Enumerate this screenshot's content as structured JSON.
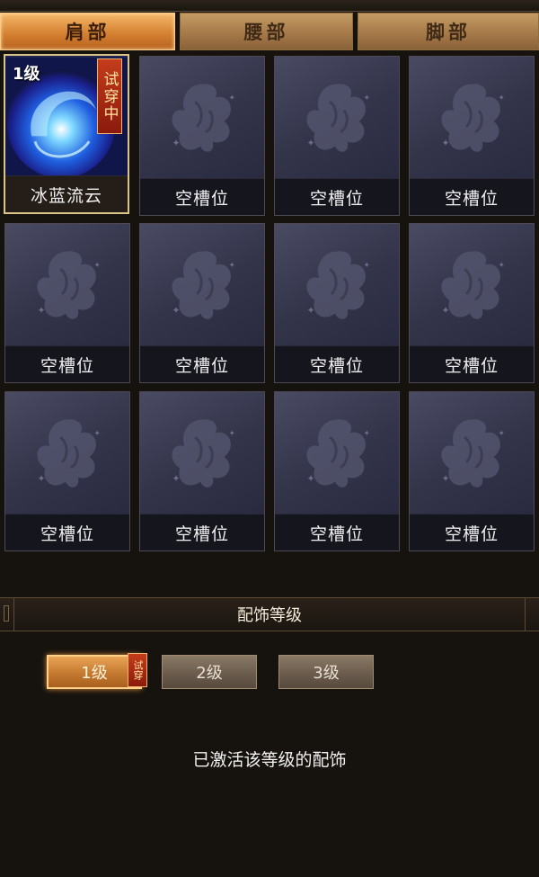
{
  "tabs": [
    {
      "label": "肩部",
      "active": true
    },
    {
      "label": "腰部",
      "active": false
    },
    {
      "label": "脚部",
      "active": false
    }
  ],
  "slots": [
    {
      "label": "冰蓝流云",
      "level": "1级",
      "tag": "试穿中",
      "filled": true
    },
    {
      "label": "空槽位"
    },
    {
      "label": "空槽位"
    },
    {
      "label": "空槽位"
    },
    {
      "label": "空槽位"
    },
    {
      "label": "空槽位"
    },
    {
      "label": "空槽位"
    },
    {
      "label": "空槽位"
    },
    {
      "label": "空槽位"
    },
    {
      "label": "空槽位"
    },
    {
      "label": "空槽位"
    },
    {
      "label": "空槽位"
    }
  ],
  "section": {
    "title": "配饰等级"
  },
  "levels": [
    {
      "label": "1级",
      "tag": "试穿",
      "active": true
    },
    {
      "label": "2级",
      "active": false
    },
    {
      "label": "3级",
      "active": false
    }
  ],
  "status_text": "已激活该等级的配饰",
  "icons": {
    "empty_slot": "butterfly-icon",
    "filled_slot": "blue-swirl-orb-icon"
  },
  "colors": {
    "tab_active": "#d27d2e",
    "tab_inactive": "#a37747",
    "slot_bg": "#33344a",
    "tag_red": "#b02a14"
  }
}
